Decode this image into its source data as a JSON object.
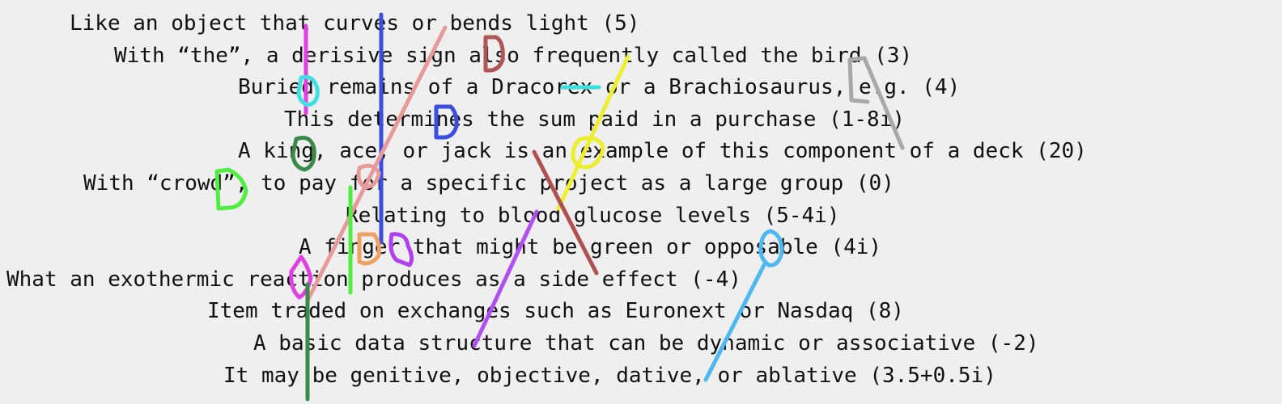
{
  "puzzle": {
    "clues": [
      "Like an object that curves or bends light (5)",
      "With “the”, a derisive sign also frequently called the bird (3)",
      "Buried remains of a Dracorex or a Brachiosaurus, e.g. (4)",
      "This determines the sum paid in a purchase (1-8i)",
      "A king, ace, or jack is an example of this component of a deck (20)",
      "With “crowd”, to pay for a specific project as a large group (0)",
      "Relating to blood glucose levels (5-4i)",
      "A finger that might be green or opposable (4i)",
      "What an exothermic reaction produces as a side effect (-4)",
      "Item traded on exchanges such as Euronext or Nasdaq (8)",
      "A basic data structure that can be dynamic or associative (-2)",
      "It may be genitive, objective, dative, or ablative (3.5+0.5i)"
    ],
    "stroke_colors": {
      "magenta": "#e040e0",
      "blue": "#3a4fe0",
      "pink": "#e89a9a",
      "maroon": "#b05555",
      "yellow": "#eeee30",
      "gray": "#a8a8a8",
      "cyan": "#40e0e0",
      "dark_green": "#3a8a4a",
      "green": "#50ee40",
      "orange": "#f0a060",
      "purple": "#b050f0",
      "light_blue": "#50b8f0",
      "brown_red": "#b05050",
      "violet": "#b040f0"
    }
  }
}
